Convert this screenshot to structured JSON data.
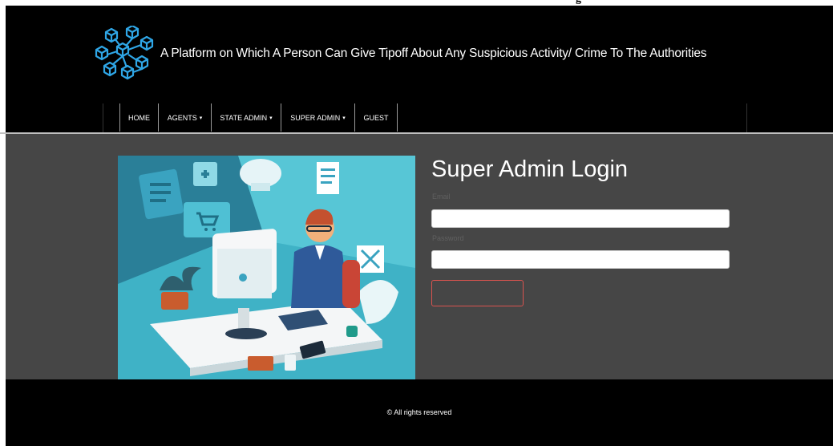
{
  "header": {
    "clipped_text": "g",
    "site_title": "A Platform on Which A Person Can Give Tipoff About Any Suspicious Activity/ Crime To The Authorities"
  },
  "nav": {
    "items": [
      {
        "label": "HOME",
        "has_dropdown": false
      },
      {
        "label": "AGENTS",
        "has_dropdown": true
      },
      {
        "label": "STATE ADMIN",
        "has_dropdown": true
      },
      {
        "label": "SUPER ADMIN",
        "has_dropdown": true
      },
      {
        "label": "GUEST",
        "has_dropdown": false
      }
    ],
    "caret": "▾"
  },
  "login": {
    "title": "Super Admin Login",
    "email_label": "Email",
    "email_value": "",
    "password_label": "Password",
    "password_value": "",
    "submit_label": ""
  },
  "footer": {
    "text": "© All rights reserved"
  },
  "colors": {
    "header_bg": "#000000",
    "main_bg": "#464646",
    "accent_red": "#d9534f",
    "logo_blue": "#2fa6e6"
  },
  "icons": {
    "logo": "blockchain-cubes-icon"
  }
}
